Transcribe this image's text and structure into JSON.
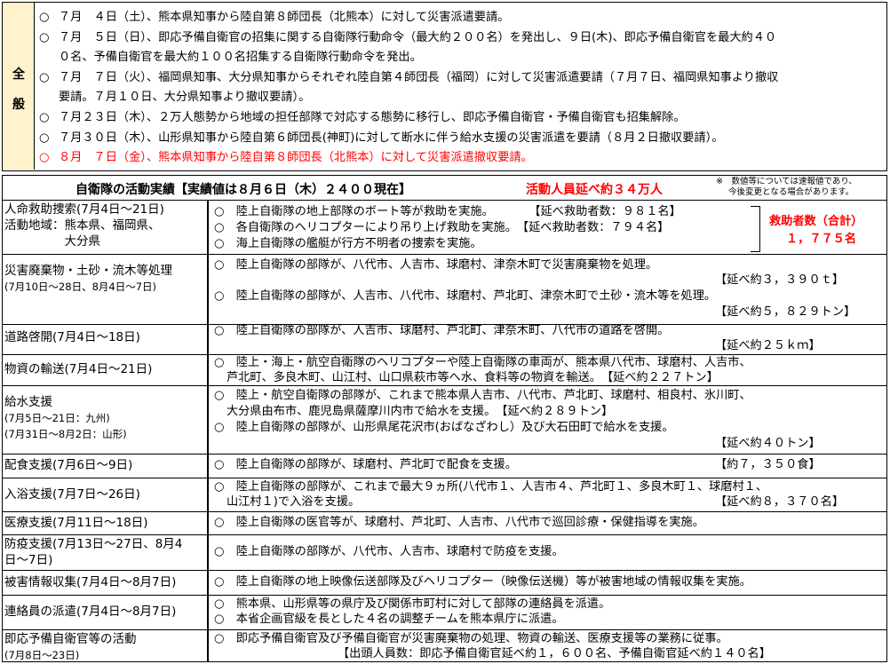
{
  "overview": {
    "label_chars": [
      "全",
      "般"
    ],
    "lines": [
      {
        "text": "７月　４日（土）、熊本県知事から陸自第８師団長（北熊本）に対して災害派遣要請。",
        "red": false,
        "mark": "○"
      },
      {
        "text": "７月　５日（日）、即応予備自衛官の招集に関する自衛隊行動命令（最大約２００名）を発出し、９日(木)、即応予備自衛官を最大約４０",
        "red": false,
        "mark": "○"
      },
      {
        "text": "０名、予備自衛官を最大約１００名招集する自衛隊行動命令を発出。",
        "red": false,
        "mark": ""
      },
      {
        "text": "７月　７日（火）、福岡県知事、大分県知事からそれぞれ陸自第４師団長（福岡）に対して災害派遣要請（７月７日、福岡県知事より撤収",
        "red": false,
        "mark": "○"
      },
      {
        "text": "要請。７月１０日、大分県知事より撤収要請）。",
        "red": false,
        "mark": ""
      },
      {
        "text": "７月２３日（木）、２万人態勢から地域の担任部隊で対応する態勢に移行し、即応予備自衛官・予備自衛官も招集解除。",
        "red": false,
        "mark": "○"
      },
      {
        "text": "７月３０日（木）、山形県知事から陸自第６師団長(神町)に対して断水に伴う給水支援の災害派遣を要請（８月２日撤収要請）。",
        "red": false,
        "mark": "○"
      },
      {
        "text": "８月　７日（金）、熊本県知事から陸自第８師団長（北熊本）に対して災害派遣撤収要請。",
        "red": true,
        "mark": "○"
      }
    ]
  },
  "header": {
    "title": "自衛隊の活動実績【実績値は８月６日（木）２４００現在】",
    "people": "活動人員延べ約３４万人",
    "note_line1": "※　数値等については速報値であり、",
    "note_line2": "今後変更となる場合があります。"
  },
  "rescue_total": {
    "label": "救助者数（合計）",
    "value": "１，７７５名"
  },
  "activities": [
    {
      "cat": [
        "人命救助捜索(7月4日～21日)",
        "活動地域：熊本県、福岡県、",
        "　　　　　大分県"
      ],
      "lines": [
        "○　陸上自衛隊の地上部隊のボート等が救助を実施。　　　　【延べ救助者数：９８１名】",
        "○　各自衛隊のヘリコプターにより吊り上げ救助を実施。　【延べ救助者数：７９４名】",
        "○　海上自衛隊の艦艇が行方不明者の捜索を実施。"
      ]
    },
    {
      "cat": [
        "災害廃棄物・土砂・流木等処理",
        "(7月10日～28日、8月4日～7日)"
      ],
      "lines": [
        "○　陸上自衛隊の部隊が、八代市、人吉市、球磨村、津奈木町で災害廃棄物を処理。",
        "【延べ約３，３９０ｔ】",
        "○　陸上自衛隊の部隊が、人吉市、八代市、球磨村、芦北町、津奈木町で土砂・流木等を処理。",
        "【延べ約５，８２９トン】"
      ]
    },
    {
      "cat": [
        "道路啓開(7月4日～18日)"
      ],
      "lines": [
        "○　陸上自衛隊の部隊が、人吉市、球磨村、芦北町、津奈木町、八代市の道路を啓開。",
        "【延べ約２５ｋｍ】"
      ]
    },
    {
      "cat": [
        "物資の輸送(7月4日～21日)"
      ],
      "lines": [
        "○　陸上・海上・航空自衛隊のヘリコプターや陸上自衛隊の車両が、熊本県八代市、球磨村、人吉市、",
        "芦北町、多良木町、山江村、山口県萩市等へ水、食料等の物資を輸送。　【延べ約２２７トン】"
      ]
    },
    {
      "cat": [
        "給水支援",
        "(7月5日～21日：九州)",
        "(7月31日～8月2日：山形)"
      ],
      "lines": [
        "○　陸上・航空自衛隊の部隊が、これまで熊本県人吉市、八代市、芦北町、球磨村、相良村、氷川町、",
        "大分県由布市、鹿児島県薩摩川内市で給水を支援。　【延べ約２８９トン】",
        "○　陸上自衛隊の部隊が、山形県尾花沢市(おばなざわし）及び大石田町で給水を支援。",
        "【延べ約４０トン】"
      ]
    },
    {
      "cat": [
        "配食支援(7月6日～9日)"
      ],
      "lines": [
        "○　陸上自衛隊の部隊が、球磨村、芦北町で配食を支援。",
        "【約７，３５０食】"
      ]
    },
    {
      "cat": [
        "入浴支援(7月7日～26日)"
      ],
      "lines": [
        "○　陸上自衛隊の部隊が、これまで最大９ヵ所(八代市１、人吉市４、芦北町１、多良木町１、球磨村１、",
        "山江村１)で入浴を支援。",
        "【延べ約８，３７０名】"
      ]
    },
    {
      "cat": [
        "医療支援(7月11日～18日)"
      ],
      "lines": [
        "○　陸上自衛隊の医官等が、球磨村、芦北町、人吉市、八代市で巡回診療・保健指導を実施。"
      ]
    },
    {
      "cat": [
        "防疫支援(7月13日～27日、8月4",
        "日～7日)"
      ],
      "lines": [
        "○　陸上自衛隊の部隊が、八代市、人吉市、球磨村で防疫を支援。"
      ]
    },
    {
      "cat": [
        "被害情報収集(7月4日～8月7日)"
      ],
      "lines": [
        "○　陸上自衛隊の地上映像伝送部隊及びヘリコプター（映像伝送機）等が被害地域の情報収集を実施。"
      ]
    },
    {
      "cat": [
        "連絡員の派遣(7月4日～8月7日)"
      ],
      "lines": [
        "○　熊本県、山形県等の県庁及び関係市町村に対して部隊の連絡員を派遣。",
        "○　本省企画官級を長とした４名の調整チームを熊本県庁に派遣。"
      ]
    },
    {
      "cat": [
        "即応予備自衛官等の活動",
        "(7月8日～23日)"
      ],
      "lines": [
        "○　即応予備自衛官及び予備自衛官が災害廃棄物の処理、物資の輸送、医療支援等の業務に従事。",
        "【出頭人員数：即応予備自衛官延べ約１，６００名、予備自衛官延べ約１４０名】"
      ]
    }
  ]
}
